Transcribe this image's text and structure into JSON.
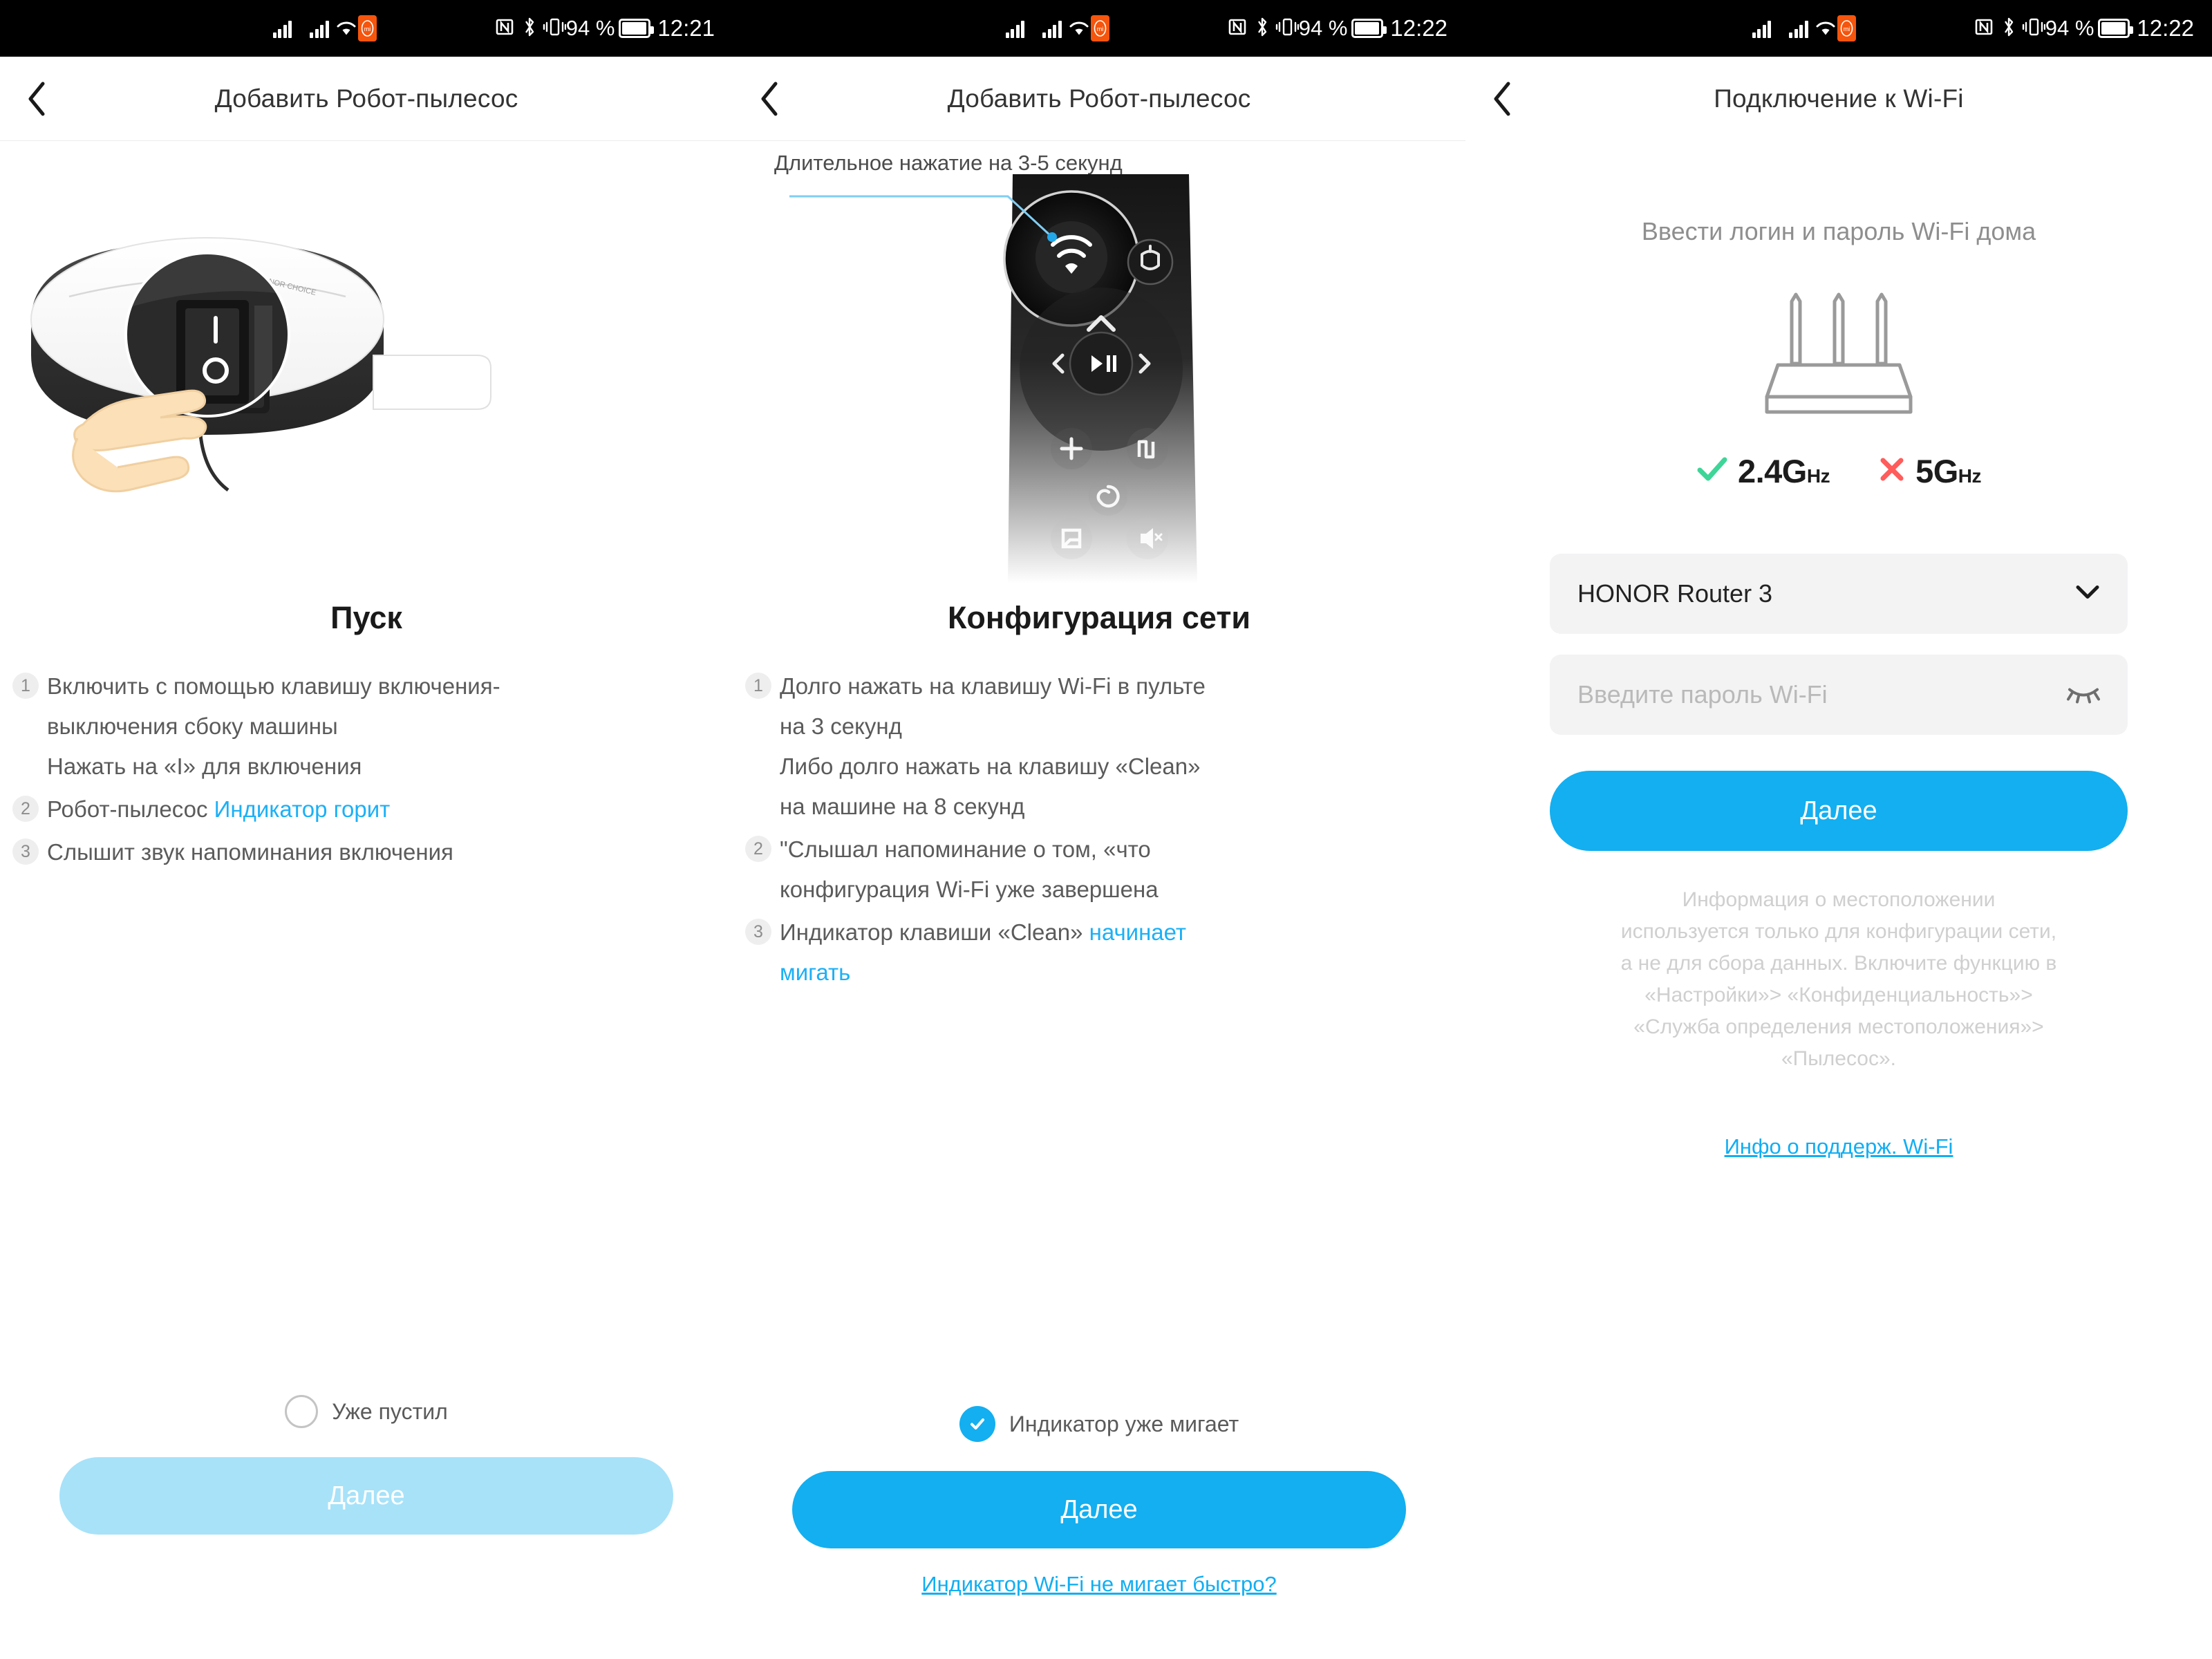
{
  "status_bars": [
    {
      "battery_percent": "94 %",
      "time": "12:21"
    },
    {
      "battery_percent": "94 %",
      "time": "12:22"
    },
    {
      "battery_percent": "94 %",
      "time": "12:22"
    }
  ],
  "screen1": {
    "nav_title": "Добавить Робот-пылесос",
    "back_icon": "chevron-left-icon",
    "illustration": "robot-vacuum-power-switch-illustration",
    "section_title": "Пуск",
    "steps": [
      {
        "num": "1",
        "lines": [
          {
            "text": "Включить с помощью клавишу включения-"
          },
          {
            "text": "выключения сбоку машины"
          },
          {
            "text": "Нажать на «I» для включения"
          }
        ]
      },
      {
        "num": "2",
        "lines": [
          {
            "text": "Робот-пылесос ",
            "highlight": "Индикатор горит"
          }
        ]
      },
      {
        "num": "3",
        "lines": [
          {
            "text": "Слышит звук напоминания включения"
          }
        ]
      }
    ],
    "checkbox_label": "Уже пустил",
    "checkbox_checked": false,
    "next_label": "Далее",
    "next_enabled": false
  },
  "screen2": {
    "nav_title": "Добавить Робот-пылесос",
    "back_icon": "chevron-left-icon",
    "hero_caption": "Длительное нажатие на 3-5 секунд",
    "illustration": "remote-control-wifi-button-illustration",
    "section_title": "Конфигурация сети",
    "steps": [
      {
        "num": "1",
        "lines": [
          {
            "text": "Долго нажать на клавишу Wi-Fi в пульте"
          },
          {
            "text": "на 3 секунд"
          },
          {
            "text": "Либо долго нажать на клавишу «Clean»"
          },
          {
            "text": "на машине на 8 секунд"
          }
        ]
      },
      {
        "num": "2",
        "lines": [
          {
            "text": "\"Слышал напоминание о том, «что"
          },
          {
            "text": "конфигурация Wi-Fi уже завершена"
          }
        ]
      },
      {
        "num": "3",
        "lines": [
          {
            "text": "Индикатор клавиши «Clean» ",
            "highlight": "начинает"
          },
          {
            "highlight": "мигать"
          }
        ]
      }
    ],
    "checkbox_label": "Индикатор уже мигает",
    "checkbox_checked": true,
    "next_label": "Далее",
    "next_enabled": true,
    "help_link": "Индикатор Wi-Fi не мигает быстро?"
  },
  "screen3": {
    "nav_title": "Подключение к Wi-Fi",
    "back_icon": "chevron-left-icon",
    "subtitle": "Ввести логин и пароль Wi-Fi дома",
    "router_icon": "wifi-router-icon",
    "bands": [
      {
        "icon": "check-icon",
        "label": "2.4G",
        "unit": "Hz",
        "color": "#3ED598"
      },
      {
        "icon": "cross-icon",
        "label": "5G",
        "unit": "Hz",
        "color": "#FF5C5C"
      }
    ],
    "ssid_field": {
      "value": "HONOR Router 3",
      "icon": "chevron-down-icon"
    },
    "password_field": {
      "placeholder": "Введите пароль Wi-Fi",
      "icon": "eye-closed-icon"
    },
    "next_label": "Далее",
    "privacy_lines": [
      "Информация о местоположении",
      "используется только для конфигурации сети,",
      "а не для сбора данных. Включите функцию в",
      "«Настройки»> «Конфиденциальность»>",
      "«Служба определения местоположения»>",
      "«Пылесос»."
    ],
    "support_link": "Инфо о поддерж. Wi-Fi"
  },
  "colors": {
    "accent": "#13AFF0",
    "accent_disabled": "#A7E2F9",
    "link": "#12AEF2",
    "ok_green": "#3ED598",
    "err_red": "#FF5C5C",
    "status_bar_bg": "#000000",
    "mi_badge": "#F5550C"
  }
}
